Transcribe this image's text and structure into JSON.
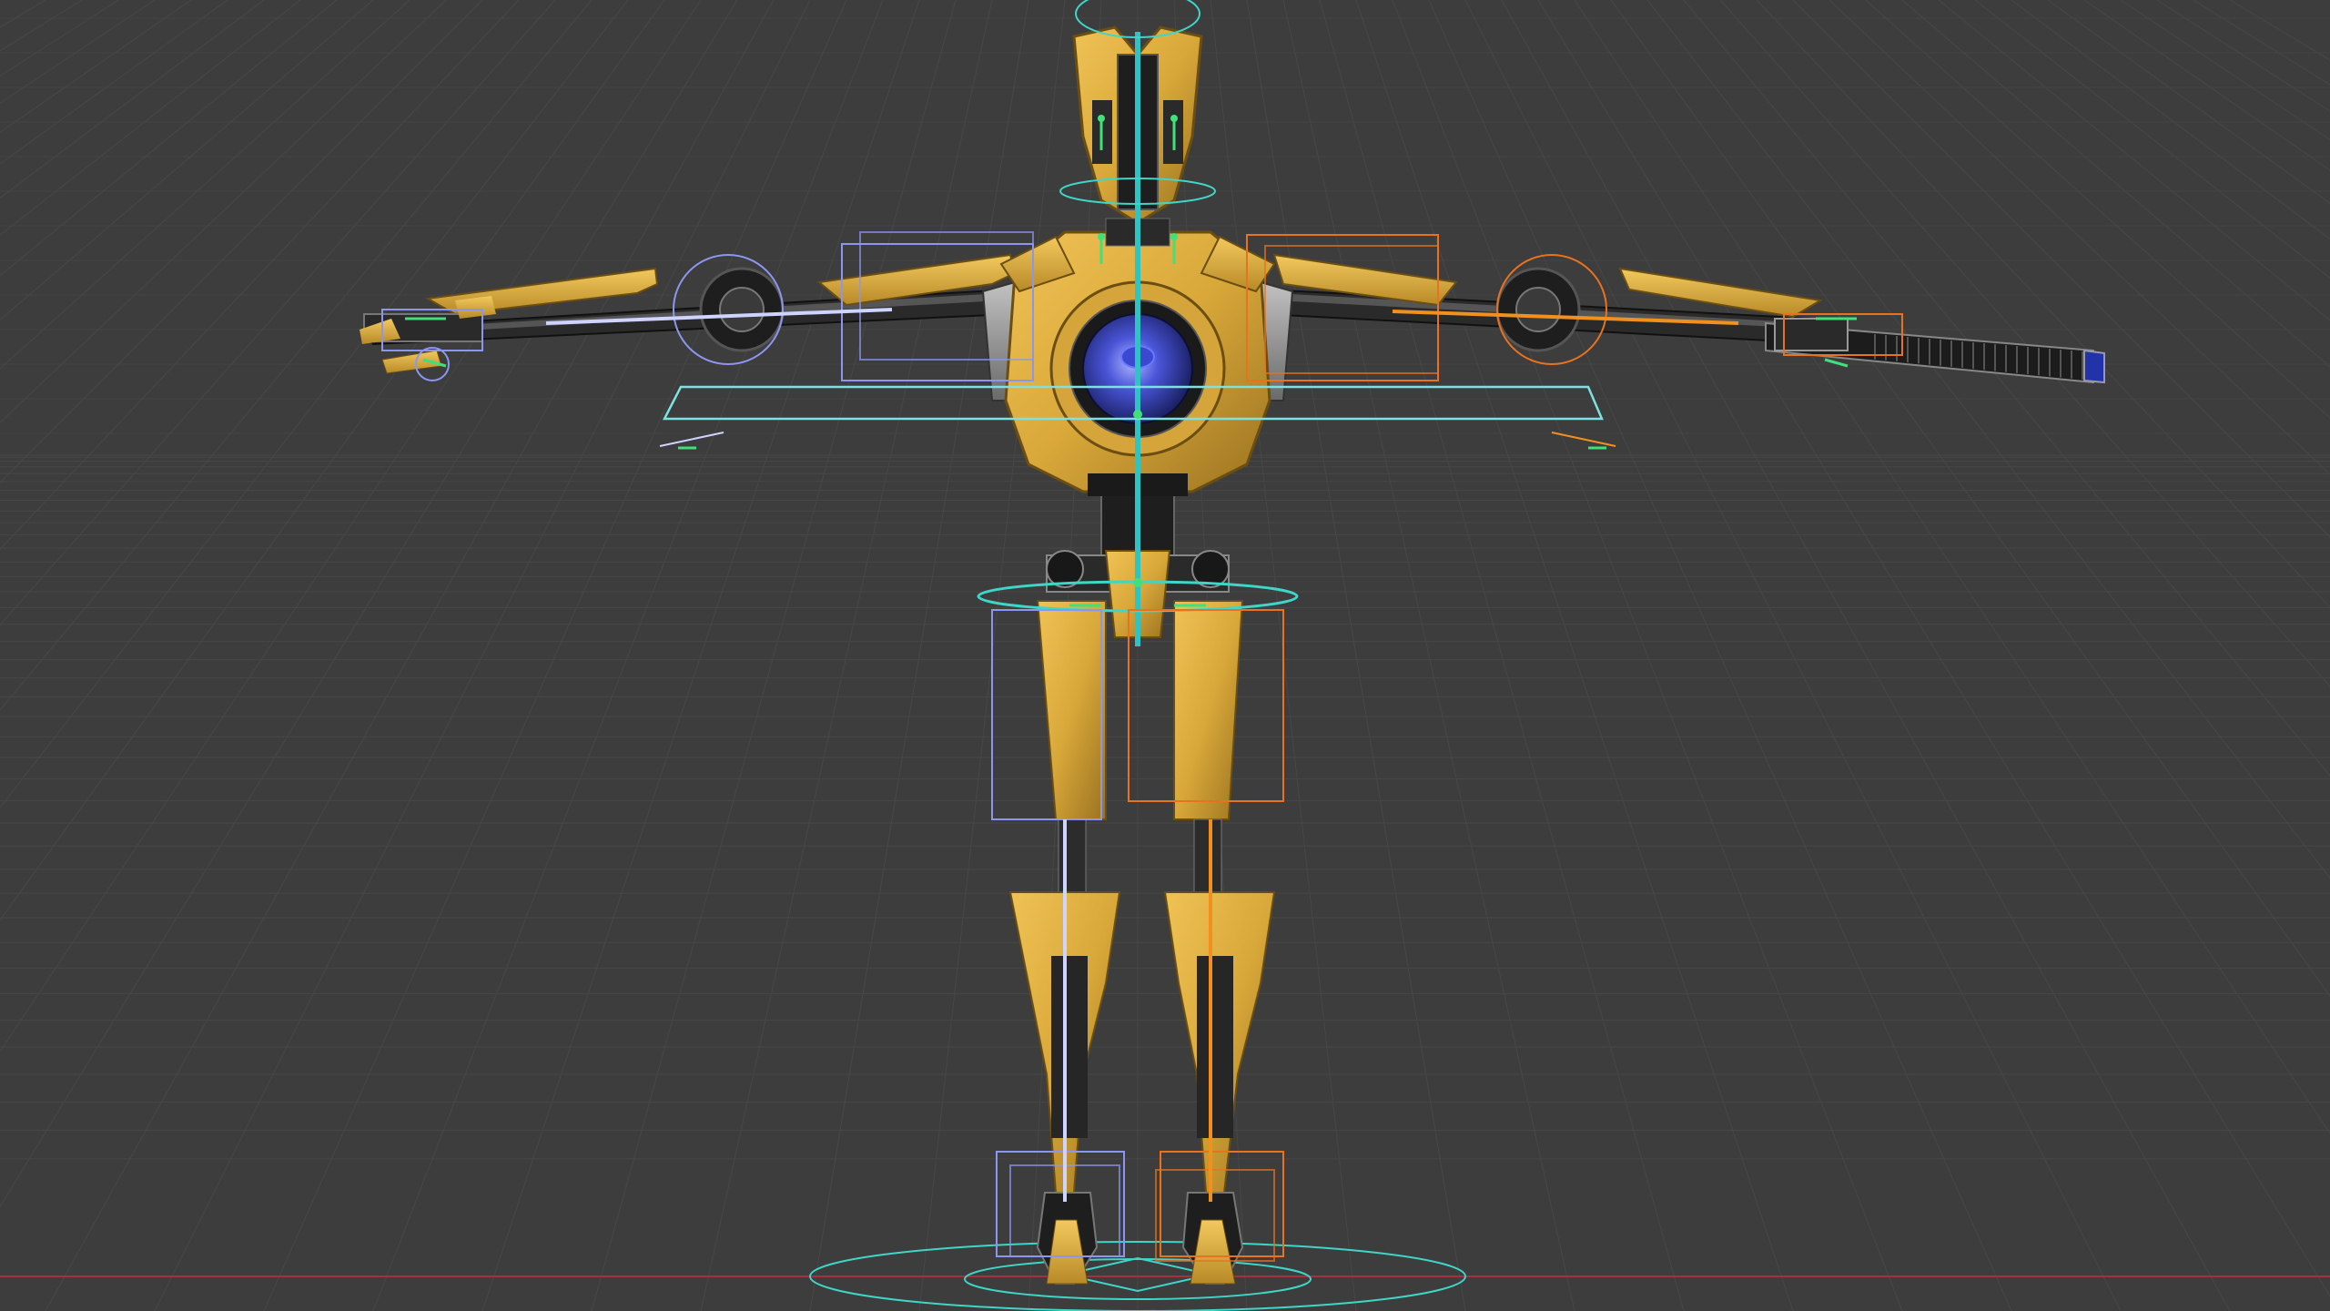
{
  "viewport": {
    "background": "#3d3d3d",
    "grid_color": "#474747",
    "x_axis_color": "#a3323a",
    "view": "front-orthographic"
  },
  "model": {
    "subject": "robot-droid-rig",
    "body_color": "#d9a83a",
    "dark_color": "#2a2a2a",
    "eye_color": "#3946c8"
  },
  "rig": {
    "center_bone_color": "#2ec4c4",
    "left_side_color": "#8c96f0",
    "right_side_color": "#e8721e",
    "control_circle_color": "#3fd6c8",
    "bone_joint_color": "#40e07a"
  }
}
